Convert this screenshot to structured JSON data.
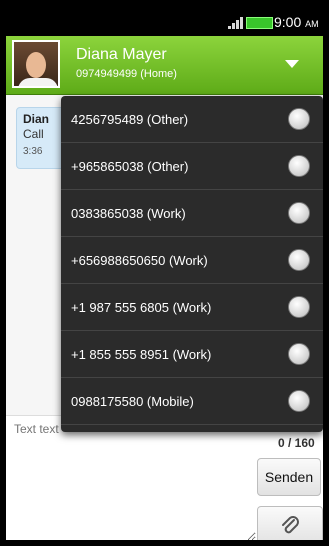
{
  "status_bar": {
    "time": "9:00",
    "ampm": "AM"
  },
  "header": {
    "name": "Diana Mayer",
    "number": "0974949499 (Home)"
  },
  "conversation": {
    "bubble_name": "Dian",
    "bubble_text": "Call",
    "bubble_time": "3:36"
  },
  "compose": {
    "placeholder": "Text text",
    "counter": "0 / 160",
    "send_label": "Senden"
  },
  "phone_options": [
    {
      "label": "4256795489 (Other)"
    },
    {
      "label": "+965865038 (Other)"
    },
    {
      "label": "0383865038 (Work)"
    },
    {
      "label": "+656988650650 (Work)"
    },
    {
      "label": "+1 987 555 6805 (Work)"
    },
    {
      "label": "+1 855 555 8951 (Work)"
    },
    {
      "label": "0988175580 (Mobile)"
    }
  ],
  "colors": {
    "accent": "#6fbf20",
    "popup": "#2b2b2b"
  }
}
